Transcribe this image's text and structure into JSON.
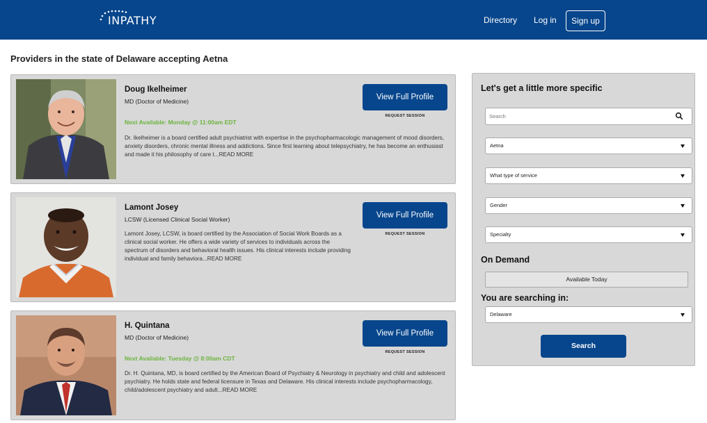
{
  "header": {
    "logo_text": "INPATHY",
    "nav": {
      "directory": "Directory",
      "login": "Log in",
      "signup": "Sign up"
    },
    "brand_color": "#07468c"
  },
  "page_title": "Providers in the state of Delaware accepting Aetna",
  "providers": [
    {
      "name": "Doug Ikelheimer",
      "credential": "MD (Doctor of Medicine)",
      "availability": "Next Available: Monday @ 11:00am EDT",
      "description": "Dr. Ikelheimer is a board certified adult psychiatrist with expertise in the psychopharmacologic management of mood disorders, anxiety disorders, chronic mental illness and addictions.  Since first learning about telepsychiatry, he has become an enthusiast and made it his philosophy of care t...",
      "read_more": "READ MORE",
      "profile_button": "View Full Profile",
      "request_session": "REQUEST SESSION"
    },
    {
      "name": "Lamont Josey",
      "credential": "LCSW (Licensed Clinical Social Worker)",
      "availability": "",
      "description": "Lamont Josey, LCSW, is board certified by the Association of Social Work Boards as a clinical social worker. He offers a wide variety of services to individuals across the spectrum of disorders and behavioral health issues. His clinical interests include providing individual and family behaviora...",
      "read_more": "READ MORE",
      "profile_button": "View Full Profile",
      "request_session": "REQUEST SESSION"
    },
    {
      "name": "H. Quintana",
      "credential": "MD (Doctor of Medicine)",
      "availability": "Next Available: Tuesday @ 8:00am CDT",
      "description": "Dr. H. Quintana, MD, is board certified by the American Board of Psychiatry & Neurology in psychiatry and child and adolescent psychiatry. He holds state and federal licensure in Texas and Delaware. His clinical interests include psychopharmacology, child/adolescent psychiatry and adult...",
      "read_more": "READ MORE",
      "profile_button": "View Full Profile",
      "request_session": "REQUEST SESSION"
    }
  ],
  "filters": {
    "title": "Let's get a little more specific",
    "search_placeholder": "Search",
    "search_icon": "search-icon",
    "insurance": "Aetna",
    "service": "What type of service",
    "gender": "Gender",
    "specialty": "Specialty",
    "on_demand_title": "On Demand",
    "available_today": "Available Today",
    "searching_in_title": "You are searching in:",
    "state": "Delaware",
    "search_button": "Search"
  },
  "colors": {
    "availability_green": "#6cb33f",
    "card_bg": "#d8d8d8"
  }
}
